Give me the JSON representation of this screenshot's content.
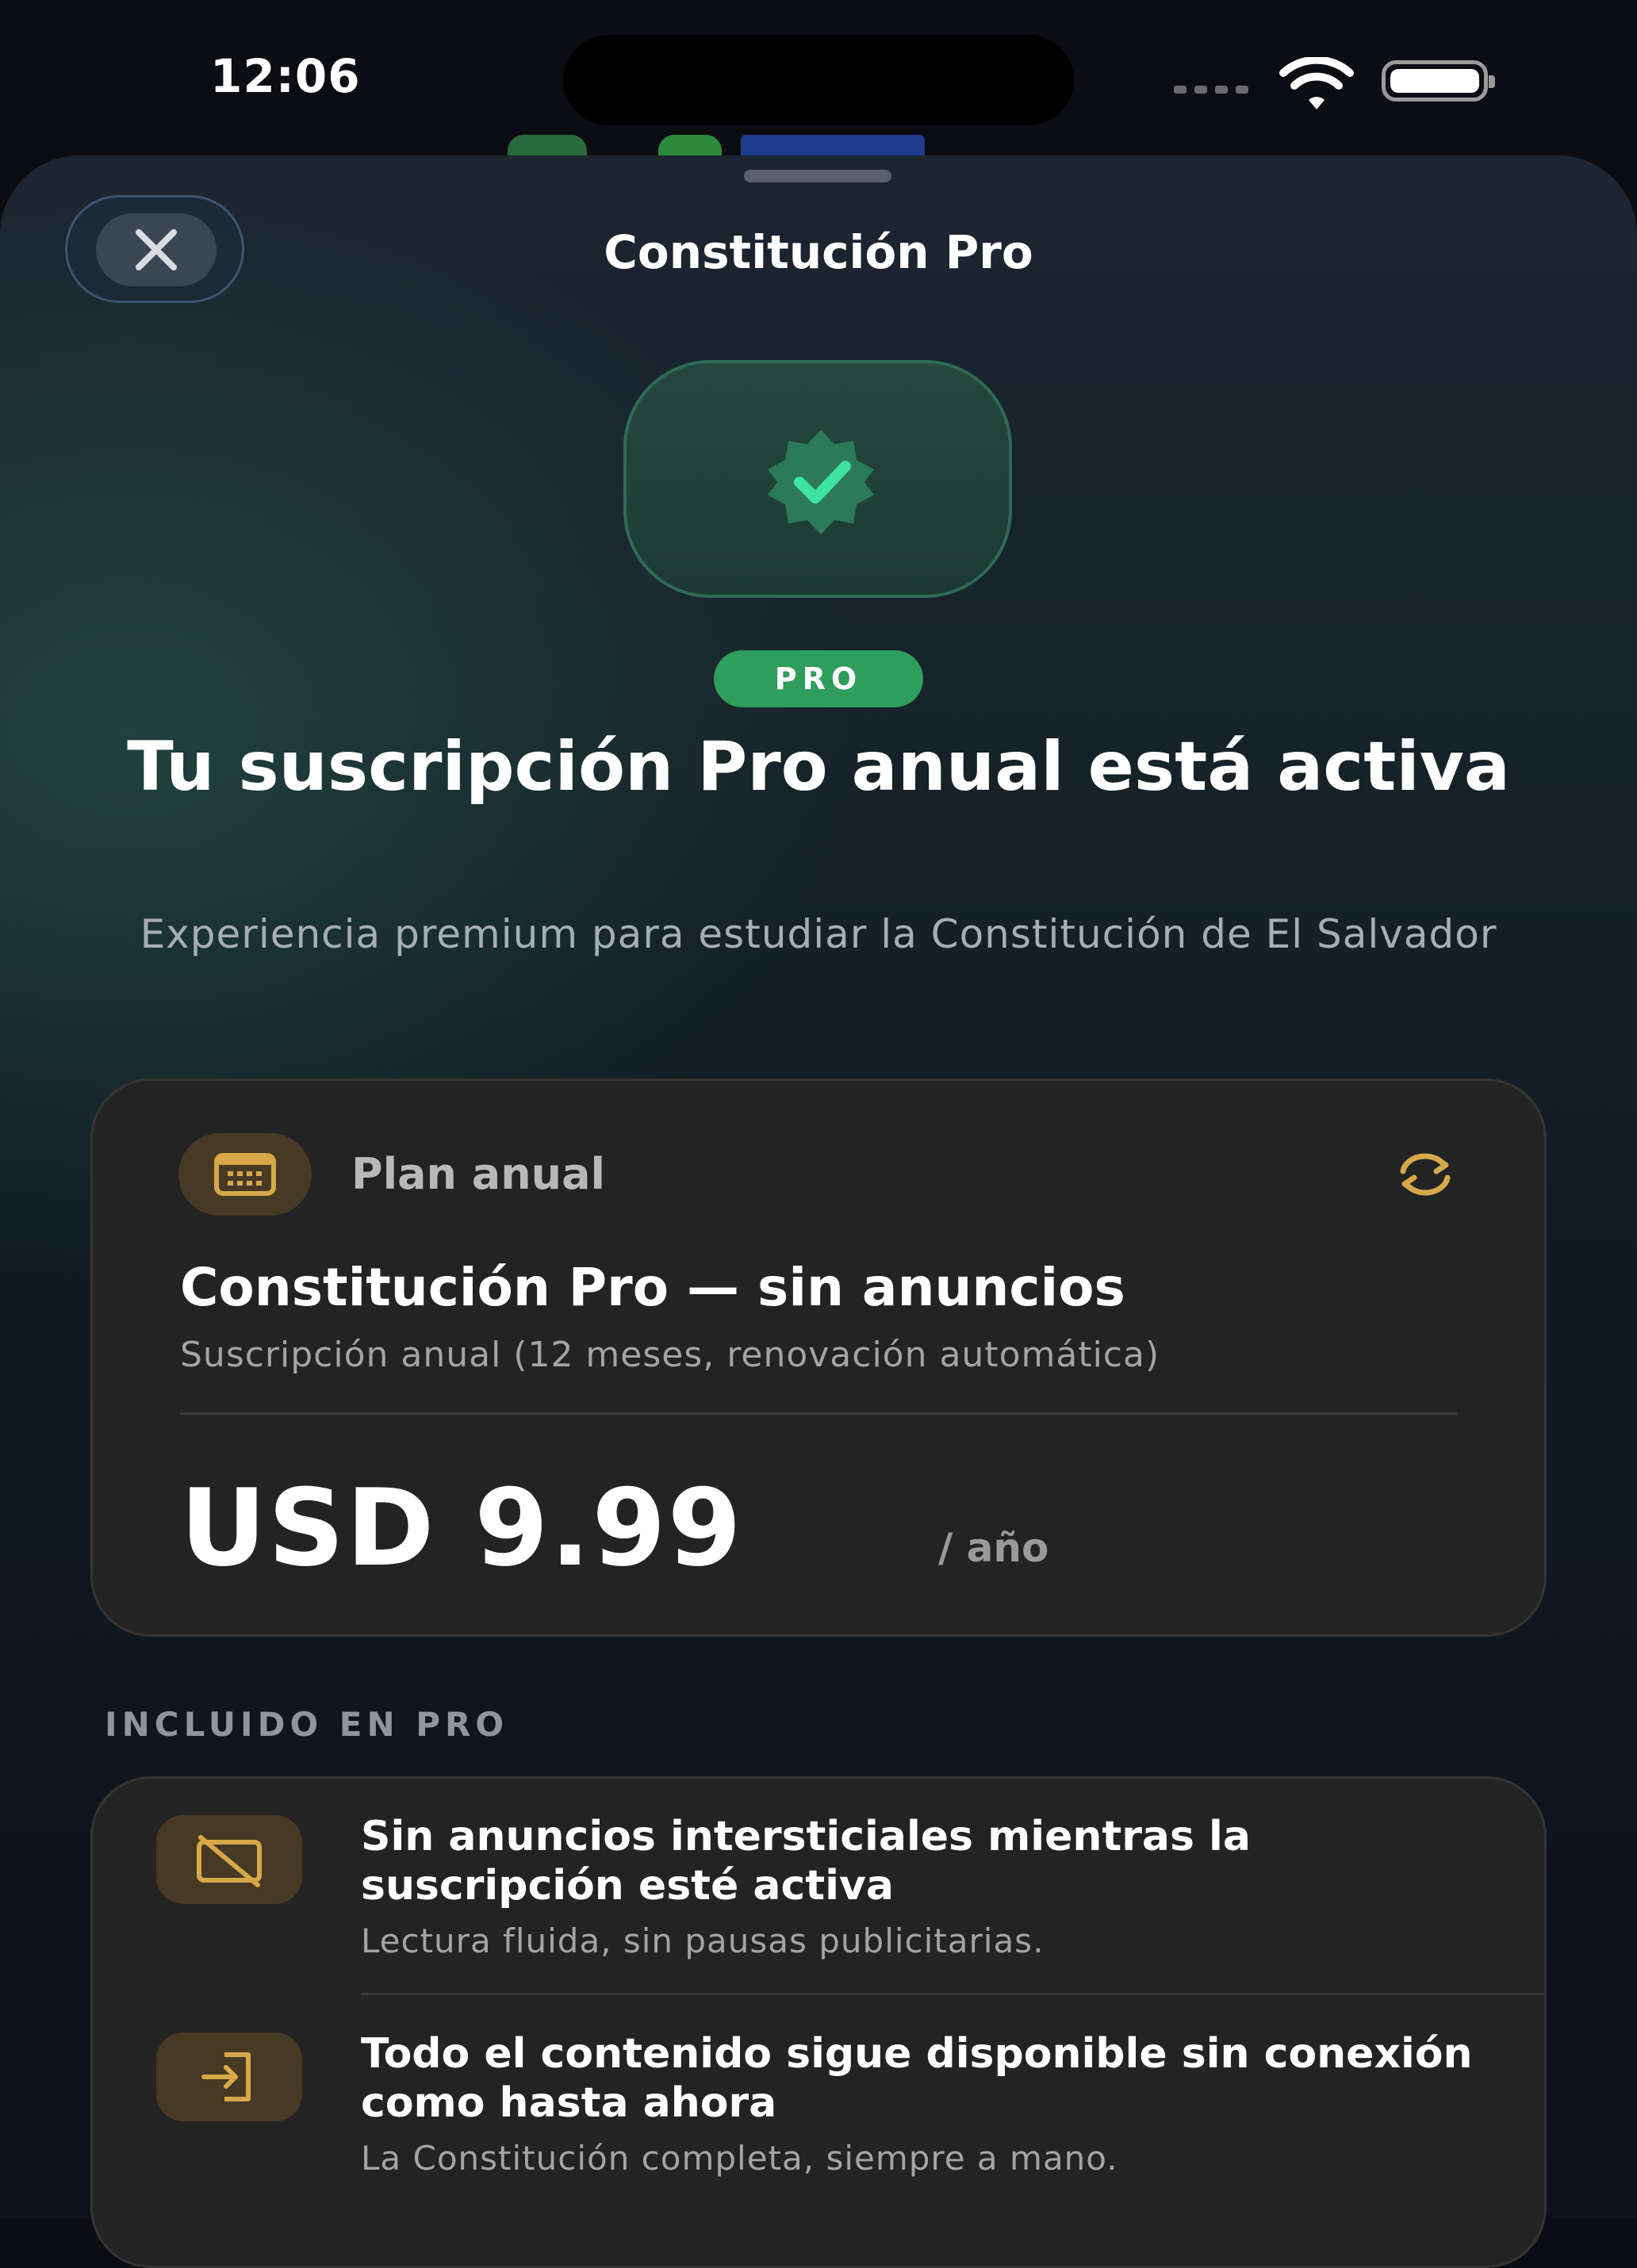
{
  "status_bar": {
    "time": "12:06"
  },
  "sheet": {
    "title": "Constitución Pro",
    "close_icon": "close-icon",
    "badge_icon": "verified-badge-icon",
    "pill": "PRO",
    "headline": "Tu suscripción Pro anual está activa",
    "subheadline": "Experiencia premium para estudiar la Constitución de El Salvador"
  },
  "plan": {
    "icon": "calendar-icon",
    "label": "Plan anual",
    "renew_icon": "renew-icon",
    "name": "Constitución Pro — sin anuncios",
    "description": "Suscripción anual (12 meses, renovación automática)",
    "price": "USD 9.99",
    "period": "/ año"
  },
  "included": {
    "section_title": "INCLUIDO EN PRO",
    "items": [
      {
        "icon": "no-ads-icon",
        "title": "Sin anuncios intersticiales mientras la suscripción esté activa",
        "description": "Lectura fluida, sin pausas publicitarias."
      },
      {
        "icon": "offline-access-icon",
        "title": "Todo el contenido sigue disponible sin conexión como hasta ahora",
        "description": "La Constitución completa, siempre a mano."
      }
    ]
  },
  "colors": {
    "accent_green": "#2f9d5c",
    "accent_gold": "#d6a84a",
    "card_bg": "#232323"
  }
}
